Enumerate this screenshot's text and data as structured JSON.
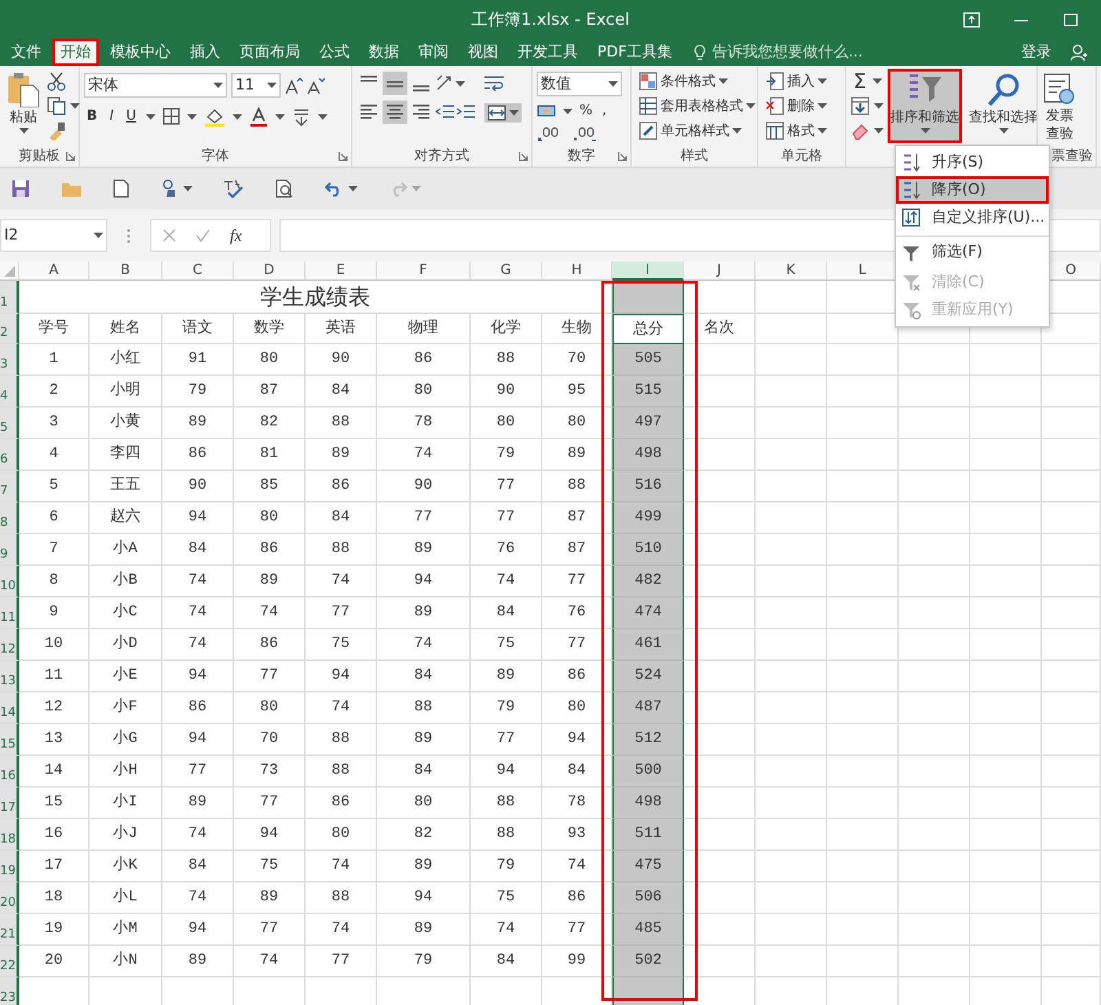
{
  "window": {
    "title": "工作簿1.xlsx - Excel"
  },
  "tabs": [
    {
      "label": "文件",
      "selected": false,
      "highlighted": false
    },
    {
      "label": "开始",
      "selected": true,
      "highlighted": true
    },
    {
      "label": "模板中心",
      "selected": false,
      "highlighted": false
    },
    {
      "label": "插入",
      "selected": false,
      "highlighted": false
    },
    {
      "label": "页面布局",
      "selected": false,
      "highlighted": false
    },
    {
      "label": "公式",
      "selected": false,
      "highlighted": false
    },
    {
      "label": "数据",
      "selected": false,
      "highlighted": false
    },
    {
      "label": "审阅",
      "selected": false,
      "highlighted": false
    },
    {
      "label": "视图",
      "selected": false,
      "highlighted": false
    },
    {
      "label": "开发工具",
      "selected": false,
      "highlighted": false
    },
    {
      "label": "PDF工具集",
      "selected": false,
      "highlighted": false
    }
  ],
  "tell_me": {
    "placeholder": "告诉我您想要做什么..."
  },
  "account": {
    "sign_in": "登录"
  },
  "ribbon": {
    "groups": [
      {
        "kind": "clipboard",
        "label": "剪贴板",
        "paste": "粘贴"
      },
      {
        "kind": "font",
        "label": "字体",
        "font_name": "宋体",
        "font_size": "11",
        "format_buttons": [
          "B",
          "I",
          "U"
        ]
      },
      {
        "kind": "alignment",
        "label": "对齐方式",
        "vertical": [
          {
            "selected": false
          },
          {
            "selected": true
          },
          {
            "selected": false
          }
        ],
        "horizontal": [
          {
            "selected": false
          },
          {
            "selected": true
          },
          {
            "selected": false
          }
        ],
        "merge": {
          "selected": true
        }
      },
      {
        "kind": "number",
        "label": "数字",
        "format": "数值",
        "percent": "%",
        "comma": ","
      },
      {
        "kind": "styles",
        "label": "样式",
        "items": [
          "条件格式",
          "套用表格格式",
          "单元格样式"
        ]
      },
      {
        "kind": "cells",
        "label": "单元格",
        "items": [
          "插入",
          "删除",
          "格式"
        ]
      },
      {
        "kind": "editing",
        "sum": "Σ",
        "sort_filter": {
          "label": "排序和筛选",
          "expanded": true,
          "highlighted": true
        },
        "find": "查找和选择"
      },
      {
        "kind": "invoice",
        "button": [
          "发票",
          "查验"
        ],
        "label": "票查验"
      }
    ]
  },
  "sort_menu": {
    "items": [
      {
        "label": "升序(S)",
        "selected": false,
        "highlighted": false,
        "disabled": false,
        "separator_before": false
      },
      {
        "label": "降序(O)",
        "selected": true,
        "highlighted": true,
        "disabled": false,
        "separator_before": false
      },
      {
        "label": "自定义排序(U)...",
        "selected": false,
        "highlighted": false,
        "disabled": false,
        "separator_before": false
      },
      {
        "label": "筛选(F)",
        "selected": false,
        "highlighted": false,
        "disabled": false,
        "separator_before": true
      },
      {
        "label": "清除(C)",
        "selected": false,
        "highlighted": false,
        "disabled": true,
        "separator_before": false
      },
      {
        "label": "重新应用(Y)",
        "selected": false,
        "highlighted": false,
        "disabled": true,
        "separator_before": false
      }
    ]
  },
  "formula_bar": {
    "name_box": "I2",
    "function_label": "fx"
  },
  "sheet": {
    "annotation_frame": true,
    "columns": [
      {
        "letter": "A",
        "selected": false
      },
      {
        "letter": "B",
        "selected": false
      },
      {
        "letter": "C",
        "selected": false
      },
      {
        "letter": "D",
        "selected": false
      },
      {
        "letter": "E",
        "selected": false
      },
      {
        "letter": "F",
        "selected": false
      },
      {
        "letter": "G",
        "selected": false
      },
      {
        "letter": "H",
        "selected": false
      },
      {
        "letter": "I",
        "selected": true
      },
      {
        "letter": "J",
        "selected": false
      },
      {
        "letter": "K",
        "selected": false
      },
      {
        "letter": "L",
        "selected": false
      },
      {
        "selected": false
      },
      {
        "selected": false
      },
      {
        "letter": "O",
        "selected": false
      }
    ],
    "rows": [
      {
        "label": "1",
        "kind": "title",
        "selected": true,
        "active": false,
        "title": "学生成绩表"
      },
      {
        "label": "2",
        "kind": "header",
        "selected": true,
        "active": true,
        "cells": [
          "学号",
          "姓名",
          "语文",
          "数学",
          "英语",
          "物理",
          "化学",
          "生物",
          "总分",
          "名次"
        ]
      },
      {
        "label": "3",
        "kind": "data",
        "selected": true,
        "active": false,
        "cells": [
          "1",
          "小红",
          "91",
          "80",
          "90",
          "86",
          "88",
          "70",
          "505"
        ]
      },
      {
        "label": "4",
        "kind": "data",
        "selected": true,
        "active": false,
        "cells": [
          "2",
          "小明",
          "79",
          "87",
          "84",
          "80",
          "90",
          "95",
          "515"
        ]
      },
      {
        "label": "5",
        "kind": "data",
        "selected": true,
        "active": false,
        "cells": [
          "3",
          "小黄",
          "89",
          "82",
          "88",
          "78",
          "80",
          "80",
          "497"
        ]
      },
      {
        "label": "6",
        "kind": "data",
        "selected": true,
        "active": false,
        "cells": [
          "4",
          "李四",
          "86",
          "81",
          "89",
          "74",
          "79",
          "89",
          "498"
        ]
      },
      {
        "label": "7",
        "kind": "data",
        "selected": true,
        "active": false,
        "cells": [
          "5",
          "王五",
          "90",
          "85",
          "86",
          "90",
          "77",
          "88",
          "516"
        ]
      },
      {
        "label": "8",
        "kind": "data",
        "selected": true,
        "active": false,
        "cells": [
          "6",
          "赵六",
          "94",
          "80",
          "84",
          "77",
          "77",
          "87",
          "499"
        ]
      },
      {
        "label": "9",
        "kind": "data",
        "selected": true,
        "active": false,
        "cells": [
          "7",
          "小A",
          "84",
          "86",
          "88",
          "89",
          "76",
          "87",
          "510"
        ]
      },
      {
        "label": "10",
        "kind": "data",
        "selected": true,
        "active": false,
        "cells": [
          "8",
          "小B",
          "74",
          "89",
          "74",
          "94",
          "74",
          "77",
          "482"
        ]
      },
      {
        "label": "11",
        "kind": "data",
        "selected": true,
        "active": false,
        "cells": [
          "9",
          "小C",
          "74",
          "74",
          "77",
          "89",
          "84",
          "76",
          "474"
        ]
      },
      {
        "label": "12",
        "kind": "data",
        "selected": true,
        "active": false,
        "cells": [
          "10",
          "小D",
          "74",
          "86",
          "75",
          "74",
          "75",
          "77",
          "461"
        ]
      },
      {
        "label": "13",
        "kind": "data",
        "selected": true,
        "active": false,
        "cells": [
          "11",
          "小E",
          "94",
          "77",
          "94",
          "84",
          "89",
          "86",
          "524"
        ]
      },
      {
        "label": "14",
        "kind": "data",
        "selected": true,
        "active": false,
        "cells": [
          "12",
          "小F",
          "86",
          "80",
          "74",
          "88",
          "79",
          "80",
          "487"
        ]
      },
      {
        "label": "15",
        "kind": "data",
        "selected": true,
        "active": false,
        "cells": [
          "13",
          "小G",
          "94",
          "70",
          "88",
          "89",
          "77",
          "94",
          "512"
        ]
      },
      {
        "label": "16",
        "kind": "data",
        "selected": true,
        "active": false,
        "cells": [
          "14",
          "小H",
          "77",
          "73",
          "88",
          "84",
          "94",
          "84",
          "500"
        ]
      },
      {
        "label": "17",
        "kind": "data",
        "selected": true,
        "active": false,
        "cells": [
          "15",
          "小I",
          "89",
          "77",
          "86",
          "80",
          "88",
          "78",
          "498"
        ]
      },
      {
        "label": "18",
        "kind": "data",
        "selected": true,
        "active": false,
        "cells": [
          "16",
          "小J",
          "74",
          "94",
          "80",
          "82",
          "88",
          "93",
          "511"
        ]
      },
      {
        "label": "19",
        "kind": "data",
        "selected": true,
        "active": false,
        "cells": [
          "17",
          "小K",
          "84",
          "75",
          "74",
          "89",
          "79",
          "74",
          "475"
        ]
      },
      {
        "label": "20",
        "kind": "data",
        "selected": true,
        "active": false,
        "cells": [
          "18",
          "小L",
          "74",
          "89",
          "88",
          "94",
          "75",
          "86",
          "506"
        ]
      },
      {
        "label": "21",
        "kind": "data",
        "selected": true,
        "active": false,
        "cells": [
          "19",
          "小M",
          "94",
          "77",
          "74",
          "89",
          "74",
          "77",
          "485"
        ]
      },
      {
        "label": "22",
        "kind": "data",
        "selected": true,
        "active": false,
        "cells": [
          "20",
          "小N",
          "89",
          "74",
          "77",
          "79",
          "84",
          "99",
          "502"
        ]
      },
      {
        "label": "23",
        "kind": "empty",
        "selected": true,
        "active": false
      }
    ]
  }
}
